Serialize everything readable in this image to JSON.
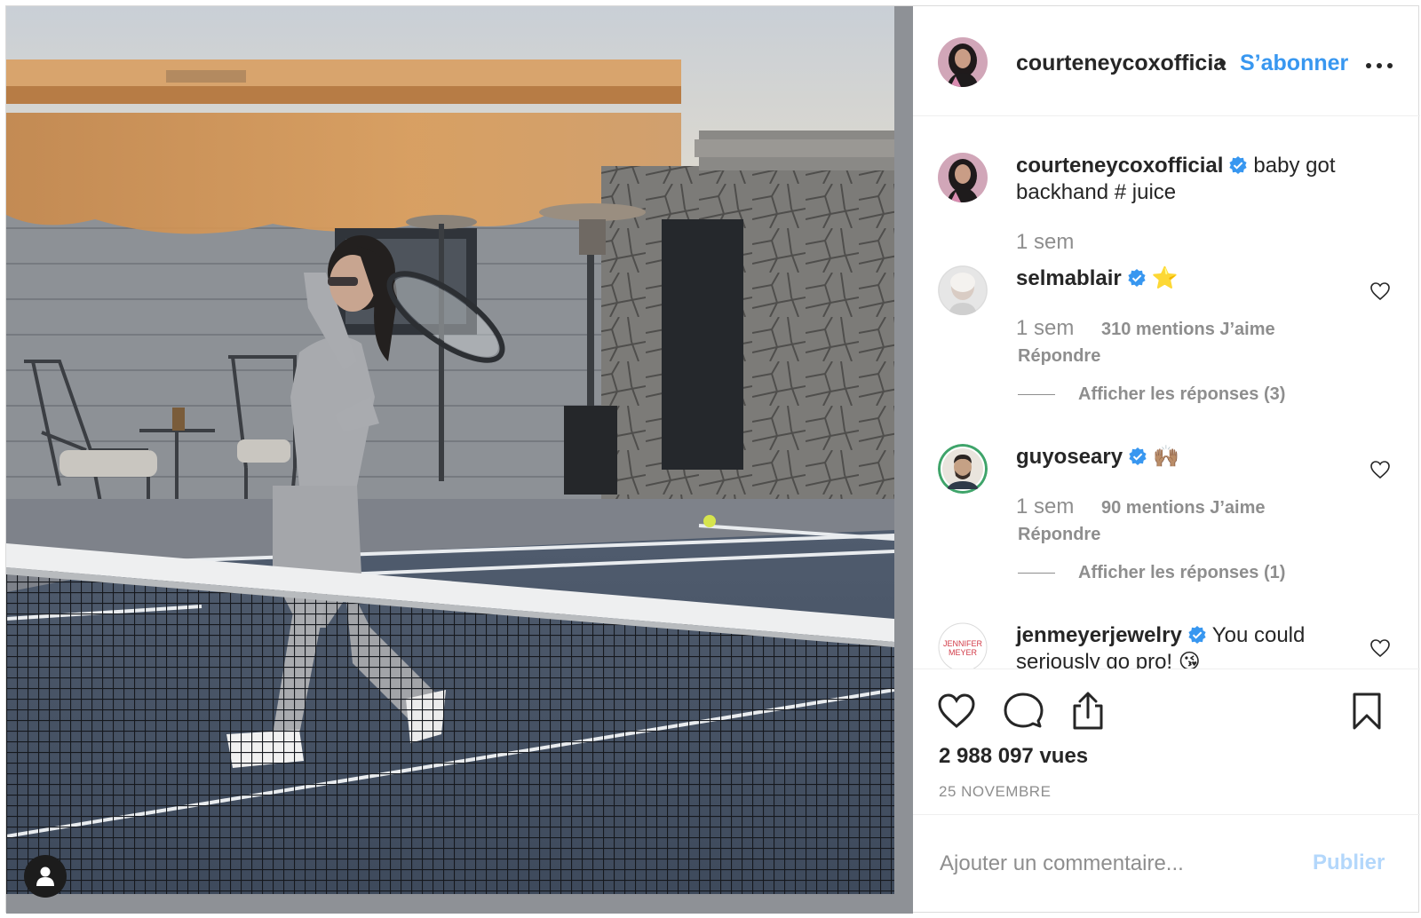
{
  "post": {
    "author": {
      "username": "courteneycoxofficial",
      "username_truncated": "courteneycoxofficia",
      "verified": true,
      "header_separator": "•",
      "follow_label": "S’abonner"
    },
    "caption": {
      "username": "courteneycoxofficial",
      "text": "baby got backhand # juice",
      "time": "1 sem"
    },
    "comments": [
      {
        "username": "selmablair",
        "verified": true,
        "text": "⭐️",
        "time": "1 sem",
        "likes": "310 mentions J’aime",
        "reply_label": "Répondre",
        "view_replies": "Afficher les réponses (3)"
      },
      {
        "username": "guyoseary",
        "verified": true,
        "text": "🙌🏽",
        "time": "1 sem",
        "likes": "90 mentions J’aime",
        "reply_label": "Répondre",
        "view_replies": "Afficher les réponses (1)"
      },
      {
        "username": "jenmeyerjewelry",
        "verified": true,
        "text": "You could seriously go pro! 😘",
        "avatar_text": "JENNIFER MEYER"
      }
    ],
    "views": "2 988 097 vues",
    "date": "25 NOVEMBRE",
    "add_comment": {
      "placeholder": "Ajouter un commentaire...",
      "publish_label": "Publier"
    },
    "colors": {
      "link_blue": "#3897f0",
      "verified_blue": "#3897f0",
      "publish_disabled": "#b3d7fb",
      "secondary_text": "#8e8e8e",
      "divider": "#efefef"
    },
    "icons": [
      "more-icon",
      "verified-badge-icon",
      "heart-outline-icon",
      "comment-icon",
      "share-icon",
      "bookmark-icon",
      "tag-user-icon"
    ]
  }
}
